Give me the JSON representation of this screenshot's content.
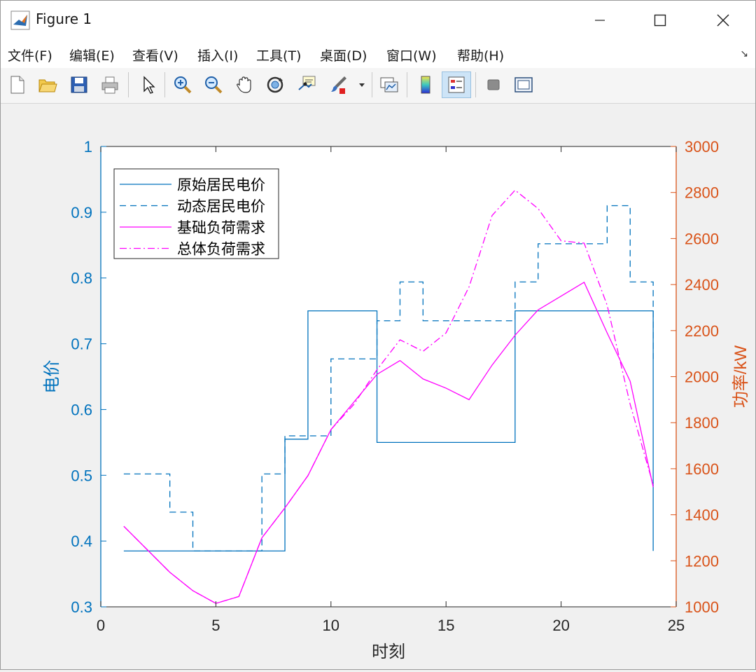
{
  "window": {
    "title": "Figure 1"
  },
  "menu": {
    "items": [
      "文件(F)",
      "编辑(E)",
      "查看(V)",
      "插入(I)",
      "工具(T)",
      "桌面(D)",
      "窗口(W)",
      "帮助(H)"
    ]
  },
  "toolbar": {
    "buttons": [
      "new-figure",
      "open-file",
      "save",
      "print",
      "edit-plot-pointer",
      "zoom-in",
      "zoom-out",
      "pan",
      "rotate-3d",
      "data-cursor",
      "brush",
      "link-plot",
      "insert-colorbar",
      "insert-legend",
      "hide-plot-tools",
      "show-plot-tools"
    ]
  },
  "colors": {
    "left_axis": "#0072BD",
    "right_axis": "#D95319",
    "magenta": "#FF00FF"
  },
  "chart_data": {
    "type": "line",
    "xlabel": "时刻",
    "ylabel_left": "电价",
    "ylabel_right": "功率/kW",
    "xlim": [
      0,
      25
    ],
    "ylim_left": [
      0.3,
      1
    ],
    "ylim_right": [
      1000,
      3000
    ],
    "xticks": [
      "0",
      "5",
      "10",
      "15",
      "20",
      "25"
    ],
    "yticks_left": [
      "0.3",
      "0.4",
      "0.5",
      "0.6",
      "0.7",
      "0.8",
      "0.9",
      "1"
    ],
    "yticks_right": [
      "1000",
      "1200",
      "1400",
      "1600",
      "1800",
      "2000",
      "2200",
      "2400",
      "2600",
      "2800",
      "3000"
    ],
    "legend_position": "top-left",
    "x": [
      1,
      2,
      3,
      4,
      5,
      6,
      7,
      8,
      9,
      10,
      11,
      12,
      13,
      14,
      15,
      16,
      17,
      18,
      19,
      20,
      21,
      22,
      23,
      24
    ],
    "series": [
      {
        "name": "原始居民电价",
        "axis": "left",
        "style": "stairs-solid",
        "color": "#0072BD",
        "values": [
          0.385,
          0.385,
          0.385,
          0.385,
          0.385,
          0.385,
          0.385,
          0.555,
          0.75,
          0.75,
          0.75,
          0.55,
          0.55,
          0.55,
          0.55,
          0.55,
          0.55,
          0.75,
          0.75,
          0.75,
          0.75,
          0.75,
          0.75,
          0.385
        ]
      },
      {
        "name": "动态居民电价",
        "axis": "left",
        "style": "stairs-dashed",
        "color": "#0072BD",
        "values": [
          0.502,
          0.502,
          0.444,
          0.385,
          0.385,
          0.385,
          0.502,
          0.56,
          0.56,
          0.677,
          0.677,
          0.735,
          0.794,
          0.735,
          0.735,
          0.735,
          0.735,
          0.794,
          0.852,
          0.852,
          0.852,
          0.91,
          0.794,
          0.677
        ]
      },
      {
        "name": "基础负荷需求",
        "axis": "right",
        "style": "solid",
        "color": "#FF00FF",
        "values": [
          1350,
          1250,
          1150,
          1070,
          1015,
          1045,
          1300,
          1430,
          1570,
          1770,
          1890,
          2010,
          2070,
          1990,
          1950,
          1900,
          2050,
          2180,
          2290,
          2350,
          2410,
          2190,
          1980,
          1520
        ]
      },
      {
        "name": "总体负荷需求",
        "axis": "right",
        "style": "dashdot",
        "color": "#FF00FF",
        "values": [
          1350,
          1250,
          1150,
          1070,
          1015,
          1045,
          1300,
          1430,
          1570,
          1770,
          1880,
          2030,
          2160,
          2110,
          2190,
          2390,
          2700,
          2810,
          2730,
          2590,
          2580,
          2310,
          1880,
          1530
        ]
      }
    ]
  }
}
